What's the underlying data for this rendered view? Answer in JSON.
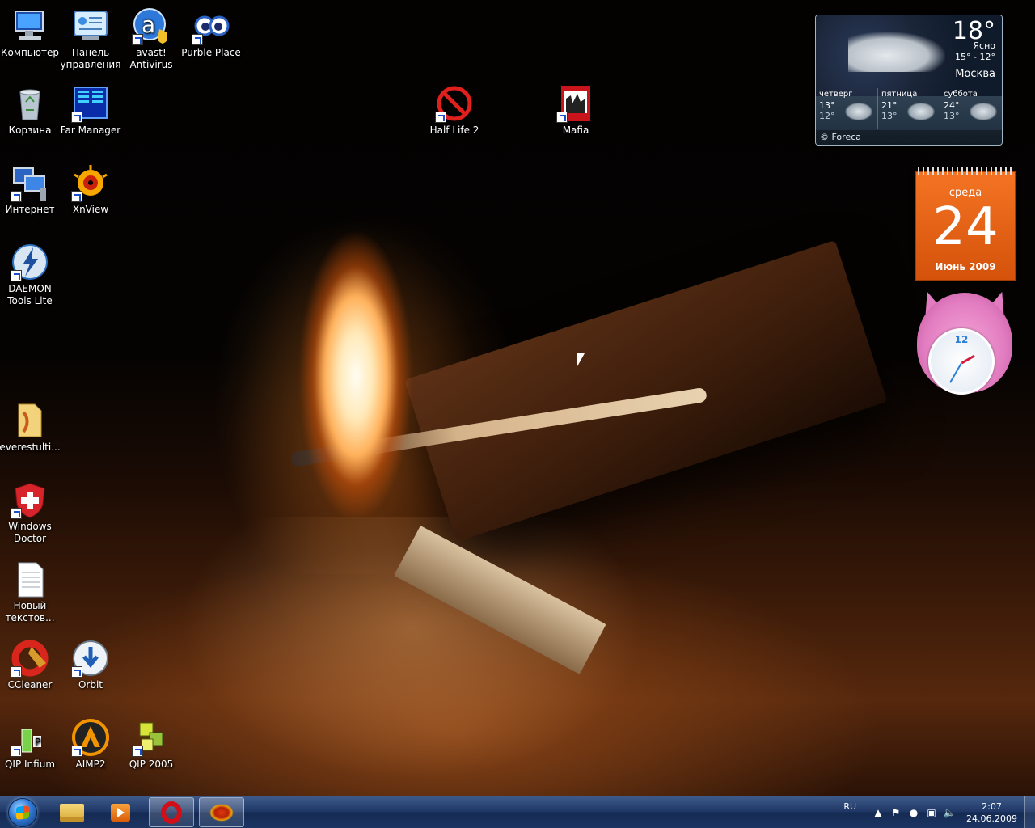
{
  "desktop": {
    "icons": [
      {
        "key": "computer",
        "label": "Компьютер"
      },
      {
        "key": "control_panel",
        "label": "Панель управления"
      },
      {
        "key": "avast",
        "label": "avast! Antivirus"
      },
      {
        "key": "purble",
        "label": "Purble Place"
      },
      {
        "key": "recycle",
        "label": "Корзина"
      },
      {
        "key": "far",
        "label": "Far Manager"
      },
      {
        "key": "internet",
        "label": "Интернет"
      },
      {
        "key": "xnview",
        "label": "XnView"
      },
      {
        "key": "daemon",
        "label": "DAEMON Tools Lite"
      },
      {
        "key": "everest",
        "label": "everestulti..."
      },
      {
        "key": "windoctor",
        "label": "Windows Doctor"
      },
      {
        "key": "newtext",
        "label": "Новый текстов..."
      },
      {
        "key": "ccleaner",
        "label": "CCleaner"
      },
      {
        "key": "orbit",
        "label": "Orbit"
      },
      {
        "key": "qip_infium",
        "label": "QIP Infium"
      },
      {
        "key": "aimp2",
        "label": "AIMP2"
      },
      {
        "key": "qip2005",
        "label": "QIP 2005"
      },
      {
        "key": "halflife2",
        "label": "Half Life 2"
      },
      {
        "key": "mafia",
        "label": "Mafia"
      }
    ]
  },
  "weather": {
    "temp": "18°",
    "condition": "Ясно",
    "range": "15° - 12°",
    "city": "Москва",
    "days": [
      {
        "name": "четверг",
        "hi": "13°",
        "lo": "12°"
      },
      {
        "name": "пятница",
        "hi": "21°",
        "lo": "13°"
      },
      {
        "name": "суббота",
        "hi": "24°",
        "lo": "13°"
      }
    ],
    "footer": "© Foreca"
  },
  "calendar": {
    "weekday": "среда",
    "day": "24",
    "month_year": "Июнь 2009"
  },
  "clock_gadget": {
    "twelve": "12"
  },
  "taskbar": {
    "language": "RU",
    "time": "2:07",
    "date": "24.06.2009",
    "buttons": [
      {
        "name": "Windows Explorer",
        "icon": "folder-icon",
        "active": false
      },
      {
        "name": "Windows Media Player",
        "icon": "media-player-icon",
        "active": false
      },
      {
        "name": "Opera",
        "icon": "opera-icon",
        "active": true
      },
      {
        "name": "XnView",
        "icon": "xnview-icon",
        "active": true
      }
    ]
  },
  "colors": {
    "taskbar": "#1f3765",
    "calendar": "#f47424"
  }
}
